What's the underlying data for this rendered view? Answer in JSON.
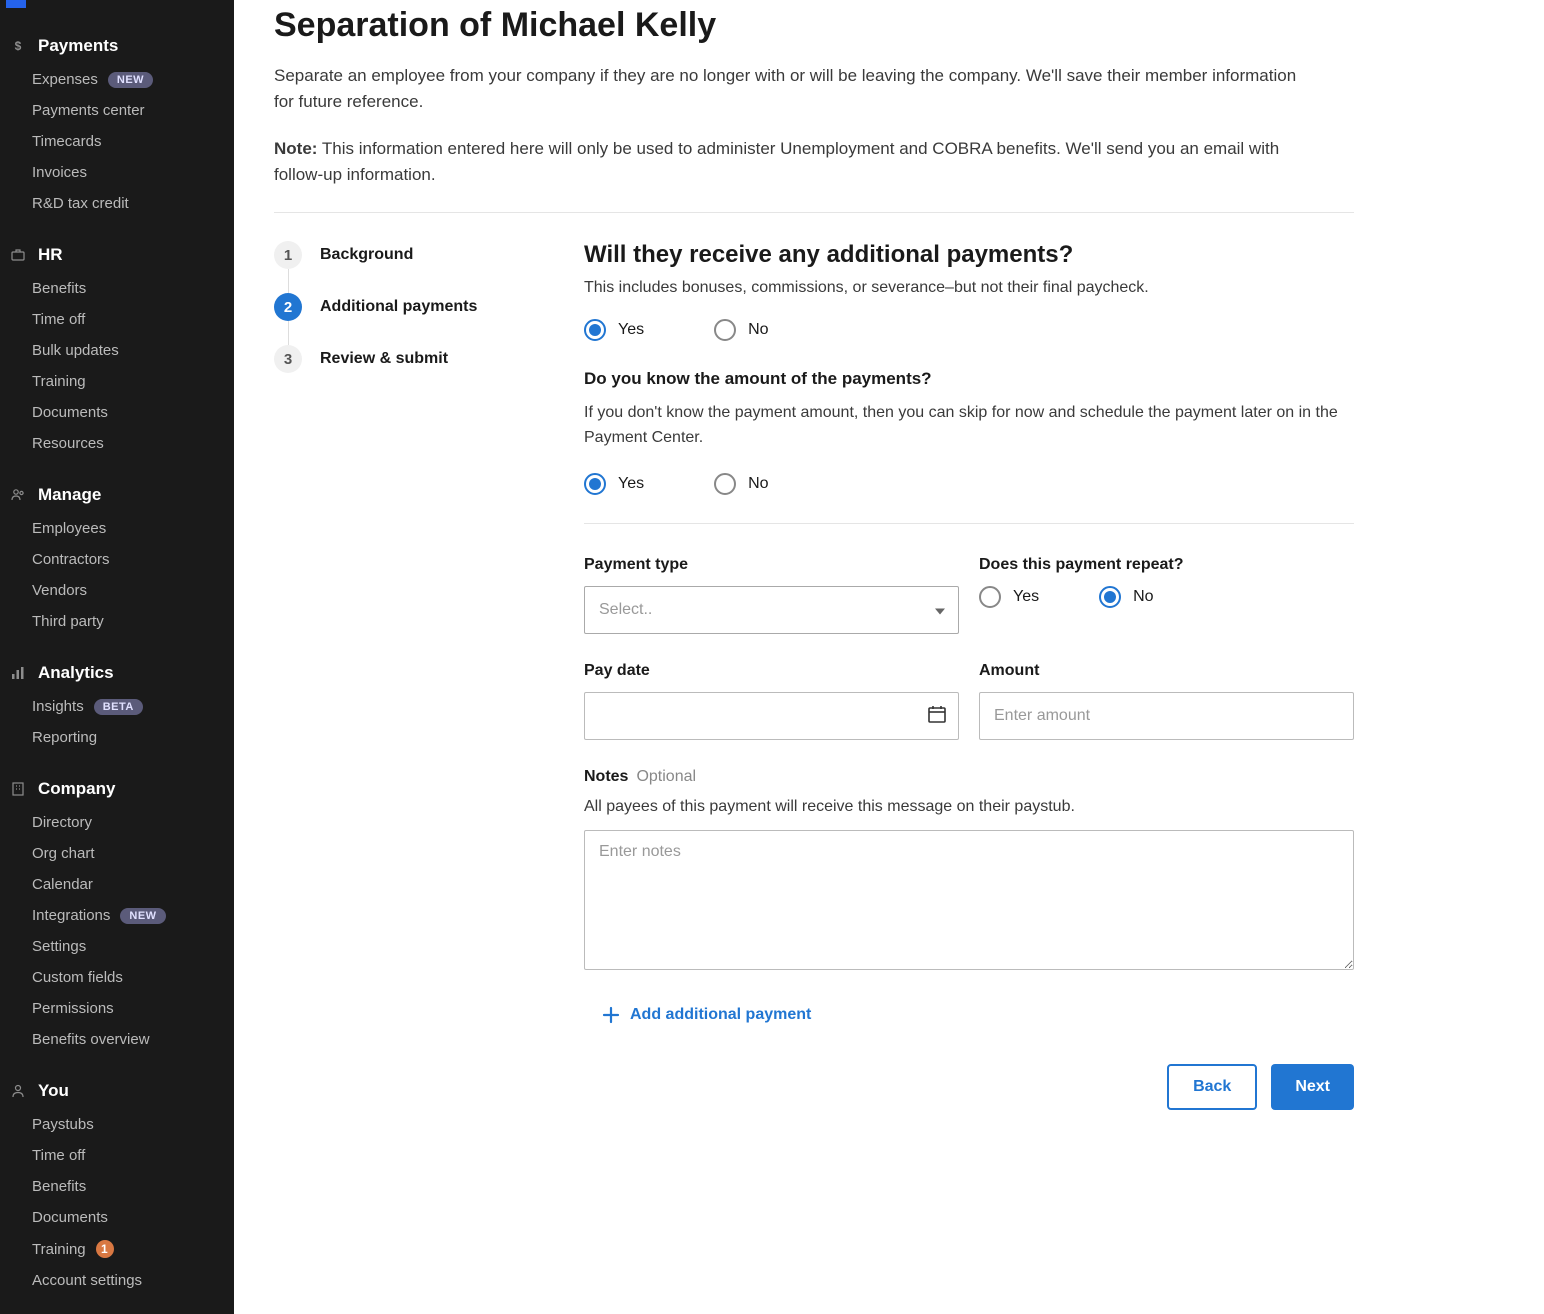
{
  "sidebar": {
    "sections": [
      {
        "title": "Payments",
        "icon": "dollar-icon",
        "items": [
          {
            "label": "Expenses",
            "badge": "NEW",
            "badgeType": "new"
          },
          {
            "label": "Payments center"
          },
          {
            "label": "Timecards"
          },
          {
            "label": "Invoices"
          },
          {
            "label": "R&D tax credit"
          }
        ]
      },
      {
        "title": "HR",
        "icon": "briefcase-icon",
        "items": [
          {
            "label": "Benefits"
          },
          {
            "label": "Time off"
          },
          {
            "label": "Bulk updates"
          },
          {
            "label": "Training"
          },
          {
            "label": "Documents"
          },
          {
            "label": "Resources"
          }
        ]
      },
      {
        "title": "Manage",
        "icon": "users-icon",
        "items": [
          {
            "label": "Employees"
          },
          {
            "label": "Contractors"
          },
          {
            "label": "Vendors"
          },
          {
            "label": "Third party"
          }
        ]
      },
      {
        "title": "Analytics",
        "icon": "chart-icon",
        "items": [
          {
            "label": "Insights",
            "badge": "BETA",
            "badgeType": "beta"
          },
          {
            "label": "Reporting"
          }
        ]
      },
      {
        "title": "Company",
        "icon": "building-icon",
        "items": [
          {
            "label": "Directory"
          },
          {
            "label": "Org chart"
          },
          {
            "label": "Calendar"
          },
          {
            "label": "Integrations",
            "badge": "NEW",
            "badgeType": "new"
          },
          {
            "label": "Settings"
          },
          {
            "label": "Custom fields"
          },
          {
            "label": "Permissions"
          },
          {
            "label": "Benefits overview"
          }
        ]
      },
      {
        "title": "You",
        "icon": "person-icon",
        "items": [
          {
            "label": "Paystubs"
          },
          {
            "label": "Time off"
          },
          {
            "label": "Benefits"
          },
          {
            "label": "Documents"
          },
          {
            "label": "Training",
            "badge": "1",
            "badgeType": "count"
          },
          {
            "label": "Account settings"
          }
        ]
      }
    ]
  },
  "page": {
    "title": "Separation of Michael Kelly",
    "intro": "Separate an employee from your company if they are no longer with or will be leaving the company. We'll save their member information for future reference.",
    "note_label": "Note:",
    "note_text": " This information entered here will only be used to administer Unemployment and COBRA benefits. We'll send you an email with follow-up information."
  },
  "steps": [
    {
      "num": "1",
      "label": "Background"
    },
    {
      "num": "2",
      "label": "Additional payments",
      "active": true
    },
    {
      "num": "3",
      "label": "Review & submit"
    }
  ],
  "form": {
    "q1_title": "Will they receive any additional payments?",
    "q1_sub": "This includes bonuses, commissions, or severance–but not their final paycheck.",
    "yes": "Yes",
    "no": "No",
    "q2_title": "Do you know the amount of the payments?",
    "q2_desc": "If you don't know the payment amount, then you can skip for now and schedule the payment later on in the Payment Center.",
    "payment_type_label": "Payment type",
    "payment_type_placeholder": "Select..",
    "repeat_label": "Does this payment repeat?",
    "pay_date_label": "Pay date",
    "amount_label": "Amount",
    "amount_placeholder": "Enter amount",
    "notes_label": "Notes",
    "notes_optional": "Optional",
    "notes_desc": "All payees of this payment will receive this message on their paystub.",
    "notes_placeholder": "Enter notes",
    "add_payment": "Add additional payment",
    "back": "Back",
    "next": "Next"
  }
}
